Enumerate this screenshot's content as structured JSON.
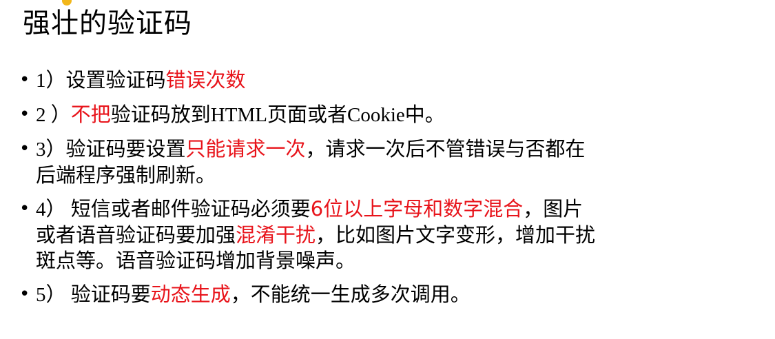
{
  "slide": {
    "title": "强壮的验证码",
    "bullet_glyph": "•",
    "accent_color": "#e8141b"
  },
  "bullets": [
    {
      "num": "1）",
      "lines": [
        [
          {
            "t": "设置验证码",
            "hl": false
          },
          {
            "t": "错误次数",
            "hl": true
          }
        ]
      ]
    },
    {
      "num": "2 ）",
      "lines": [
        [
          {
            "t": "不把",
            "hl": true
          },
          {
            "t": "验证码放到",
            "hl": false
          },
          {
            "t": "HTML",
            "hl": false,
            "latin": true
          },
          {
            "t": "页面或者",
            "hl": false
          },
          {
            "t": "Cookie",
            "hl": false,
            "latin": true
          },
          {
            "t": "中。",
            "hl": false
          }
        ]
      ]
    },
    {
      "num": "3）",
      "lines": [
        [
          {
            "t": "验证码要设置",
            "hl": false
          },
          {
            "t": "只能请求一次",
            "hl": true
          },
          {
            "t": "，请求一次后不管错误与否都在",
            "hl": false
          }
        ],
        [
          {
            "t": "后端程序强制刷新。",
            "hl": false
          }
        ]
      ]
    },
    {
      "num": "4） ",
      "lines": [
        [
          {
            "t": "短信或者邮件验证码必须要",
            "hl": false
          },
          {
            "t": "6位以上字母和数字混合",
            "hl": true
          },
          {
            "t": "，图片",
            "hl": false
          }
        ],
        [
          {
            "t": "或者语音验证码要加强",
            "hl": false
          },
          {
            "t": "混淆干扰",
            "hl": true
          },
          {
            "t": "，比如图片文字变形，增加干扰",
            "hl": false
          }
        ],
        [
          {
            "t": "斑点等。语音验证码增加背景噪声。",
            "hl": false
          }
        ]
      ]
    },
    {
      "num": "5） ",
      "lines": [
        [
          {
            "t": "验证码要",
            "hl": false
          },
          {
            "t": "动态生成",
            "hl": true
          },
          {
            "t": "，不能统一生成多次调用。",
            "hl": false
          }
        ]
      ]
    }
  ]
}
